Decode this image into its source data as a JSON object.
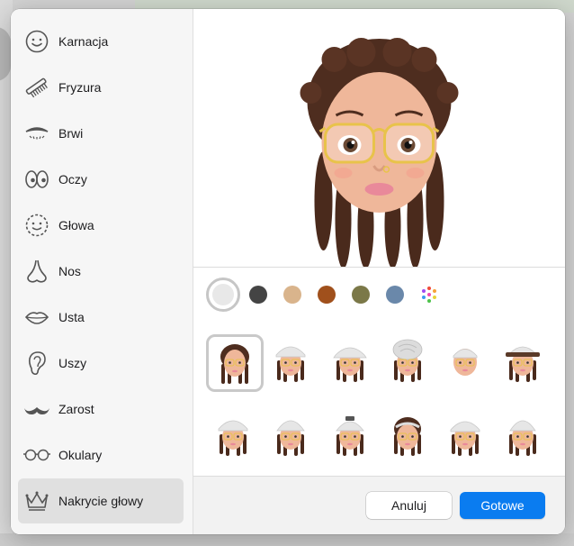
{
  "sidebar": {
    "items": [
      {
        "label": "Karnacja",
        "icon": "face-smile-icon"
      },
      {
        "label": "Fryzura",
        "icon": "comb-icon"
      },
      {
        "label": "Brwi",
        "icon": "eyebrow-icon"
      },
      {
        "label": "Oczy",
        "icon": "eyes-icon"
      },
      {
        "label": "Głowa",
        "icon": "head-shape-icon"
      },
      {
        "label": "Nos",
        "icon": "nose-icon"
      },
      {
        "label": "Usta",
        "icon": "lips-icon"
      },
      {
        "label": "Uszy",
        "icon": "ear-icon"
      },
      {
        "label": "Zarost",
        "icon": "mustache-icon"
      },
      {
        "label": "Okulary",
        "icon": "glasses-icon"
      },
      {
        "label": "Nakrycie głowy",
        "icon": "crown-icon"
      }
    ],
    "selected": "Nakrycie głowy"
  },
  "colors": {
    "swatches": [
      "#e8e8e8",
      "#444444",
      "#d9b48c",
      "#a0501c",
      "#7b7848",
      "#6a88aa",
      "multicolor"
    ],
    "selected_index": 0
  },
  "headwear": {
    "options": [
      "none",
      "white-cap",
      "white-cap",
      "white-turban",
      "white-cap-bald",
      "white-brimmed-hat",
      "white-cap",
      "white-beanie",
      "white-bonnet",
      "white-helmet",
      "white-cap",
      "white-bucket-hat"
    ],
    "selected_index": 0
  },
  "footer": {
    "cancel_label": "Anuluj",
    "done_label": "Gotowe"
  }
}
